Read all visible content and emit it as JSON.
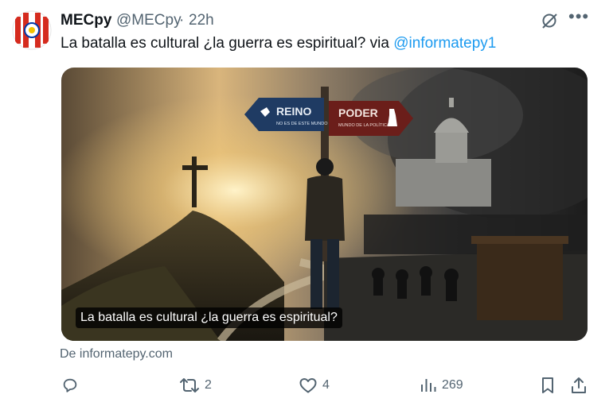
{
  "tweet": {
    "name": "MECpy",
    "handle": "@MECpy",
    "separator": "·",
    "time": "22h",
    "text_prefix": "La batalla es cultural ¿la guerra es espiritual? via ",
    "mention": "@informatepy1",
    "card_caption": "La batalla es cultural ¿la guerra es espiritual?",
    "card_source": "De informatepy.com",
    "sign_left_title": "REINO",
    "sign_left_sub": "NO ES DE ESTE MUNDO",
    "sign_right_title": "PODER",
    "sign_right_sub": "MUNDO DE LA POLÍTICA"
  },
  "actions": {
    "reply": {
      "icon": "reply-icon",
      "count": ""
    },
    "retweet": {
      "icon": "retweet-icon",
      "count": "2"
    },
    "like": {
      "icon": "heart-icon",
      "count": "4"
    },
    "views": {
      "icon": "views-icon",
      "count": "269"
    },
    "bookmark": {
      "icon": "bookmark-icon"
    },
    "share": {
      "icon": "share-icon"
    }
  },
  "colors": {
    "link": "#1d9bf0",
    "muted": "#536471",
    "text": "#0f1419",
    "sign_left": "#1f3b63",
    "sign_right": "#6b1e1a"
  }
}
